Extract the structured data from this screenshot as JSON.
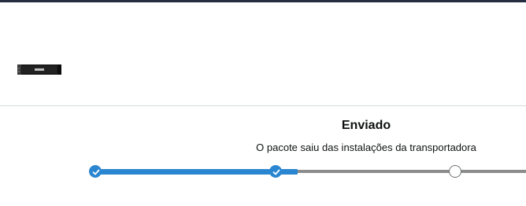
{
  "header": {
    "accent_color": "#232f3e"
  },
  "order": {
    "product_image_icon": "product-thumbnail-ssd"
  },
  "tracking": {
    "status_title": "Enviado",
    "status_description": "O pacote saiu das instalações da transportadora",
    "progress": 0.42,
    "active_color": "#2a86d1",
    "inactive_color": "#8c8c8c",
    "steps": [
      {
        "state": "completed",
        "icon": "check-icon"
      },
      {
        "state": "completed",
        "icon": "check-icon"
      },
      {
        "state": "pending",
        "icon": "empty-circle-icon"
      }
    ]
  }
}
